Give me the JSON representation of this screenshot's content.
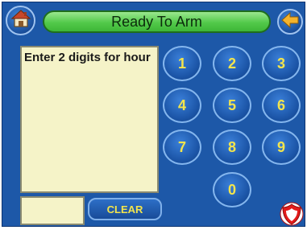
{
  "header": {
    "title": "Ready To Arm",
    "home_icon": "house-icon",
    "back_icon": "arrow-left-icon"
  },
  "message": {
    "text": "Enter 2 digits for hour"
  },
  "entry": {
    "value": ""
  },
  "buttons": {
    "clear_label": "CLEAR"
  },
  "keypad": {
    "keys": [
      "1",
      "2",
      "3",
      "4",
      "5",
      "6",
      "7",
      "8",
      "9",
      "0"
    ]
  },
  "footer": {
    "emergency_icon": "shield-icon"
  },
  "colors": {
    "background": "#1d58a8",
    "title_bar": "#52c94a",
    "key_text": "#f3e44c",
    "message_box": "#f5f3c8",
    "emergency": "#e31b1b"
  }
}
